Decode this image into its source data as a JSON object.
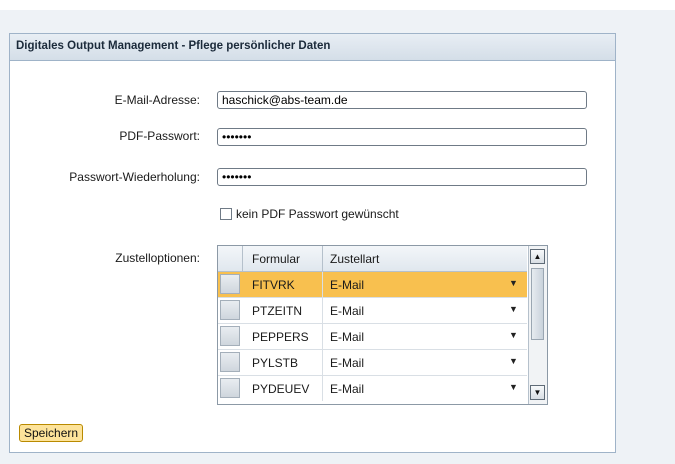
{
  "panel": {
    "title": "Digitales Output Management - Pflege persönlicher Daten"
  },
  "form": {
    "email_label": "E-Mail-Adresse:",
    "email_value": "haschick@abs-team.de",
    "pdf_pw_label": "PDF-Passwort:",
    "pdf_pw_value": "•••••••",
    "pw_repeat_label": "Passwort-Wiederholung:",
    "pw_repeat_value": "•••••••",
    "no_pdf_pw_label": "kein PDF Passwort gewünscht",
    "no_pdf_pw_checked": false,
    "delivery_label": "Zustelloptionen:"
  },
  "grid": {
    "columns": [
      "Formular",
      "Zustellart"
    ],
    "rows": [
      {
        "formular": "FITVRK",
        "zustellart": "E-Mail",
        "selected": true
      },
      {
        "formular": "PTZEITN",
        "zustellart": "E-Mail",
        "selected": false
      },
      {
        "formular": "PEPPERS",
        "zustellart": "E-Mail",
        "selected": false
      },
      {
        "formular": "PYLSTB",
        "zustellart": "E-Mail",
        "selected": false
      },
      {
        "formular": "PYDEUEV",
        "zustellart": "E-Mail",
        "selected": false
      }
    ]
  },
  "actions": {
    "save_label": "Speichern"
  },
  "icons": {
    "dropdown": "chevron-down-icon",
    "scroll_up": "arrow-up-icon",
    "scroll_down": "arrow-down-icon"
  }
}
